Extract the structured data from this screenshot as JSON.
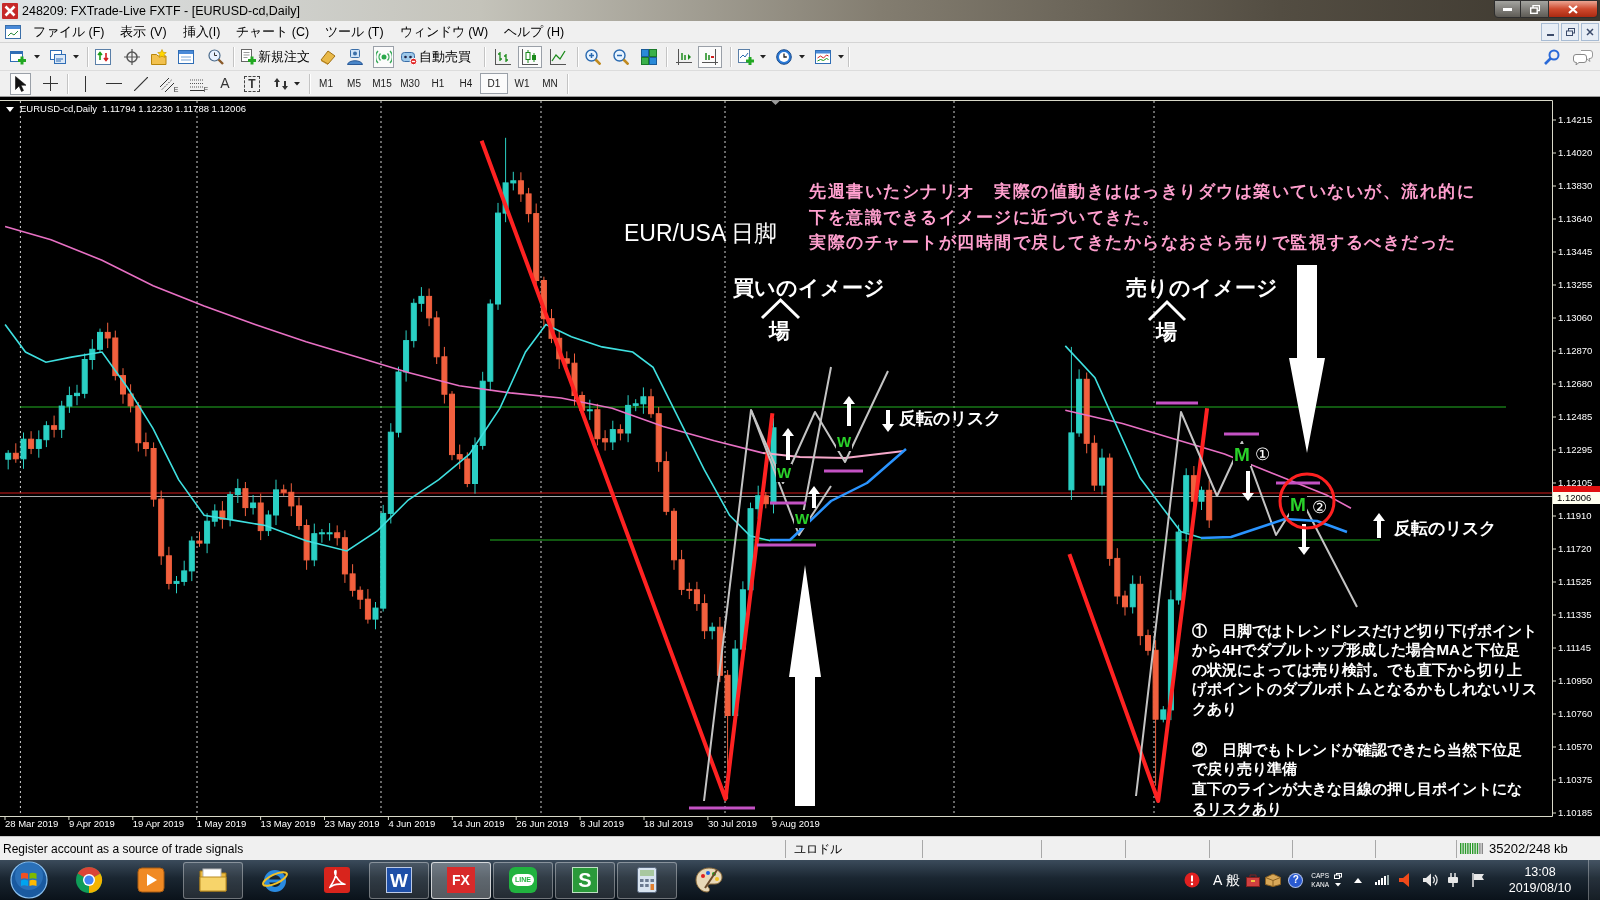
{
  "window": {
    "title": "248209: FXTrade-Live FXTF - [EURUSD-cd,Daily]"
  },
  "menu": [
    {
      "label": "ファイル (F)"
    },
    {
      "label": "表示 (V)"
    },
    {
      "label": "挿入(I)"
    },
    {
      "label": "チャート (C)"
    },
    {
      "label": "ツール (T)"
    },
    {
      "label": "ウィンドウ (W)"
    },
    {
      "label": "ヘルプ (H)"
    }
  ],
  "toolbar": {
    "new_order": "新規注文",
    "auto_trading": "自動売買",
    "signals": {
      "on": true
    },
    "chart_types": [
      {
        "selected": false
      },
      {
        "selected": true
      },
      {
        "selected": false
      }
    ],
    "auto_scroll": {
      "on": true
    }
  },
  "drawing_toolbar": {
    "cursors": [
      {
        "selected": true
      },
      {
        "selected": false
      }
    ],
    "tools": [
      {
        "kind": "vline"
      },
      {
        "kind": "hline"
      },
      {
        "kind": "trendline"
      },
      {
        "kind": "channel",
        "label": "E"
      },
      {
        "kind": "fibo",
        "label": "F"
      },
      {
        "kind": "text",
        "label": "A"
      },
      {
        "kind": "textlabel",
        "label": "T"
      },
      {
        "kind": "arrows"
      }
    ],
    "timeframes": [
      {
        "label": "M1",
        "selected": false
      },
      {
        "label": "M5",
        "selected": false
      },
      {
        "label": "M15",
        "selected": false
      },
      {
        "label": "M30",
        "selected": false
      },
      {
        "label": "H1",
        "selected": false
      },
      {
        "label": "H4",
        "selected": false
      },
      {
        "label": "D1",
        "selected": true
      },
      {
        "label": "W1",
        "selected": false
      },
      {
        "label": "MN",
        "selected": false
      }
    ]
  },
  "chart": {
    "symbol": "EURUSD-cd,Daily",
    "quote": "1.11794 1.12230 1.11788 1.12006",
    "price_axis": [
      "1.14215",
      "1.14020",
      "1.13830",
      "1.13640",
      "1.13445",
      "1.13255",
      "1.13060",
      "1.12870",
      "1.12680",
      "1.12485",
      "1.12295",
      "1.12105",
      "1.11910",
      "1.11720",
      "1.11525",
      "1.11335",
      "1.11145",
      "1.10950",
      "1.10760",
      "1.10570",
      "1.10375",
      "1.10185"
    ],
    "current_price": "1.12006",
    "time_axis": [
      "28 Mar 2019",
      "9 Apr 2019",
      "19 Apr 2019",
      "1 May 2019",
      "13 May 2019",
      "23 May 2019",
      "4 Jun 2019",
      "14 Jun 2019",
      "26 Jun 2019",
      "8 Jul 2019",
      "18 Jul 2019",
      "30 Jul 2019",
      "9 Aug 2019"
    ],
    "heading": "EUR/USA 日脚",
    "scenario": {
      "lines": [
        "先週書いたシナリオ　実際の値動きははっきりダウは築いていないが、流れ的に",
        "下を意識できるイメージに近づいてきた。",
        "実際のチャートが四時間で戻してきたからなおさら売りで監視するべきだった"
      ]
    },
    "buy_image": {
      "label": "買いのイメージ",
      "place": "場"
    },
    "sell_image": {
      "label": "売りのイメージ",
      "place": "場"
    },
    "reversal_risks": [
      "反転のリスク",
      "反転のリスク"
    ],
    "double_bottom_marks": [
      "W",
      "W",
      "W"
    ],
    "double_top_marks": [
      "M",
      "M"
    ],
    "point_numbers": [
      "①",
      "②"
    ],
    "notes": [
      {
        "lines": [
          "①　日脚ではトレンドレスだけど切り下げポイント",
          "から4Hでダブルトップ形成した場合MAと下位足",
          "の状況によっては売り検討。でも直下から切り上",
          "げポイントのダブルボトムとなるかもしれないリス",
          "クあり"
        ]
      },
      {
        "lines": [
          "②　日脚でもトレンドが確認できたら当然下位足",
          "で戻り売り準備"
        ]
      },
      {
        "lines": [
          "直下のラインが大きな目線の押し目ポイントにな",
          "るリスクあり"
        ]
      }
    ]
  },
  "status_bar": {
    "message": "Register account as a source of trade signals",
    "symbol": "ユロドル",
    "traffic": "35202/248 kb"
  },
  "taskbar": {
    "apps": [
      {
        "kind": "chrome",
        "running": false,
        "selected": false
      },
      {
        "kind": "media",
        "running": false,
        "selected": false
      },
      {
        "kind": "explorer",
        "running": true,
        "selected": false
      },
      {
        "kind": "ie",
        "running": false,
        "selected": false
      },
      {
        "kind": "acrobat",
        "running": false,
        "selected": false
      },
      {
        "kind": "word",
        "label": "W",
        "running": true,
        "selected": false
      },
      {
        "kind": "fx",
        "label": "FX",
        "running": true,
        "selected": true
      },
      {
        "kind": "line",
        "label": "LINE",
        "running": true,
        "selected": false
      },
      {
        "kind": "sheet",
        "label": "S",
        "running": true,
        "selected": false
      },
      {
        "kind": "calculator",
        "running": true,
        "selected": false
      },
      {
        "kind": "paint",
        "running": false,
        "selected": false
      }
    ],
    "tray": {
      "ime_mode": "A",
      "ime_input": "般",
      "help": "?",
      "caps": "CAPS",
      "kana": "KANA",
      "time": "13:08",
      "date": "2019/08/10"
    }
  }
}
